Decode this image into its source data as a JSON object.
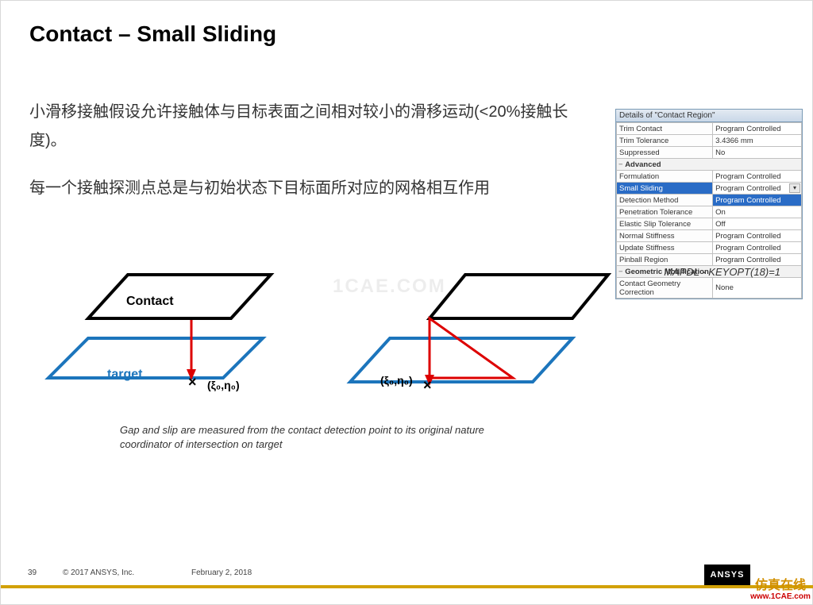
{
  "title": "Contact – Small Sliding",
  "para1": "小滑移接触假设允许接触体与目标表面之间相对较小的滑移运动(<20%接触长度)。",
  "para2": "每一个接触探测点总是与初始状态下目标面所对应的网格相互作用",
  "watermark": "1CAE.COM",
  "diagram": {
    "label_contact": "Contact",
    "label_target": "target",
    "coord": "(ξ₀,η₀)",
    "caption": "Gap and slip are measured from the contact detection point to its original nature coordinator of intersection on target"
  },
  "panel": {
    "title": "Details of \"Contact Region\"",
    "rows": [
      {
        "k": "Trim Contact",
        "v": "Program Controlled"
      },
      {
        "k": "Trim Tolerance",
        "v": "3.4366 mm"
      },
      {
        "k": "Suppressed",
        "v": "No"
      },
      {
        "section": "Advanced"
      },
      {
        "k": "Formulation",
        "v": "Program Controlled"
      },
      {
        "k": "Small Sliding",
        "v": "Program Controlled",
        "hl": true,
        "dropdown": true
      },
      {
        "k": "Detection Method",
        "v": "Program Controlled",
        "hv": true
      },
      {
        "k": "Penetration Tolerance",
        "v": "On"
      },
      {
        "k": "Elastic Slip Tolerance",
        "v": "Off"
      },
      {
        "k": "Normal Stiffness",
        "v": "Program Controlled"
      },
      {
        "k": "Update Stiffness",
        "v": "Program Controlled"
      },
      {
        "k": "Pinball Region",
        "v": "Program Controlled"
      },
      {
        "section": "Geometric Modification"
      },
      {
        "k": "Contact Geometry Correction",
        "v": "None"
      }
    ],
    "note": "MAPDL - KEYOPT(18)=1"
  },
  "footer": {
    "page": "39",
    "copyright": "© 2017 ANSYS, Inc.",
    "date": "February 2, 2018",
    "logo": "ANSYS",
    "site_cn": "仿真在线",
    "site_url": "www.1CAE.com"
  }
}
